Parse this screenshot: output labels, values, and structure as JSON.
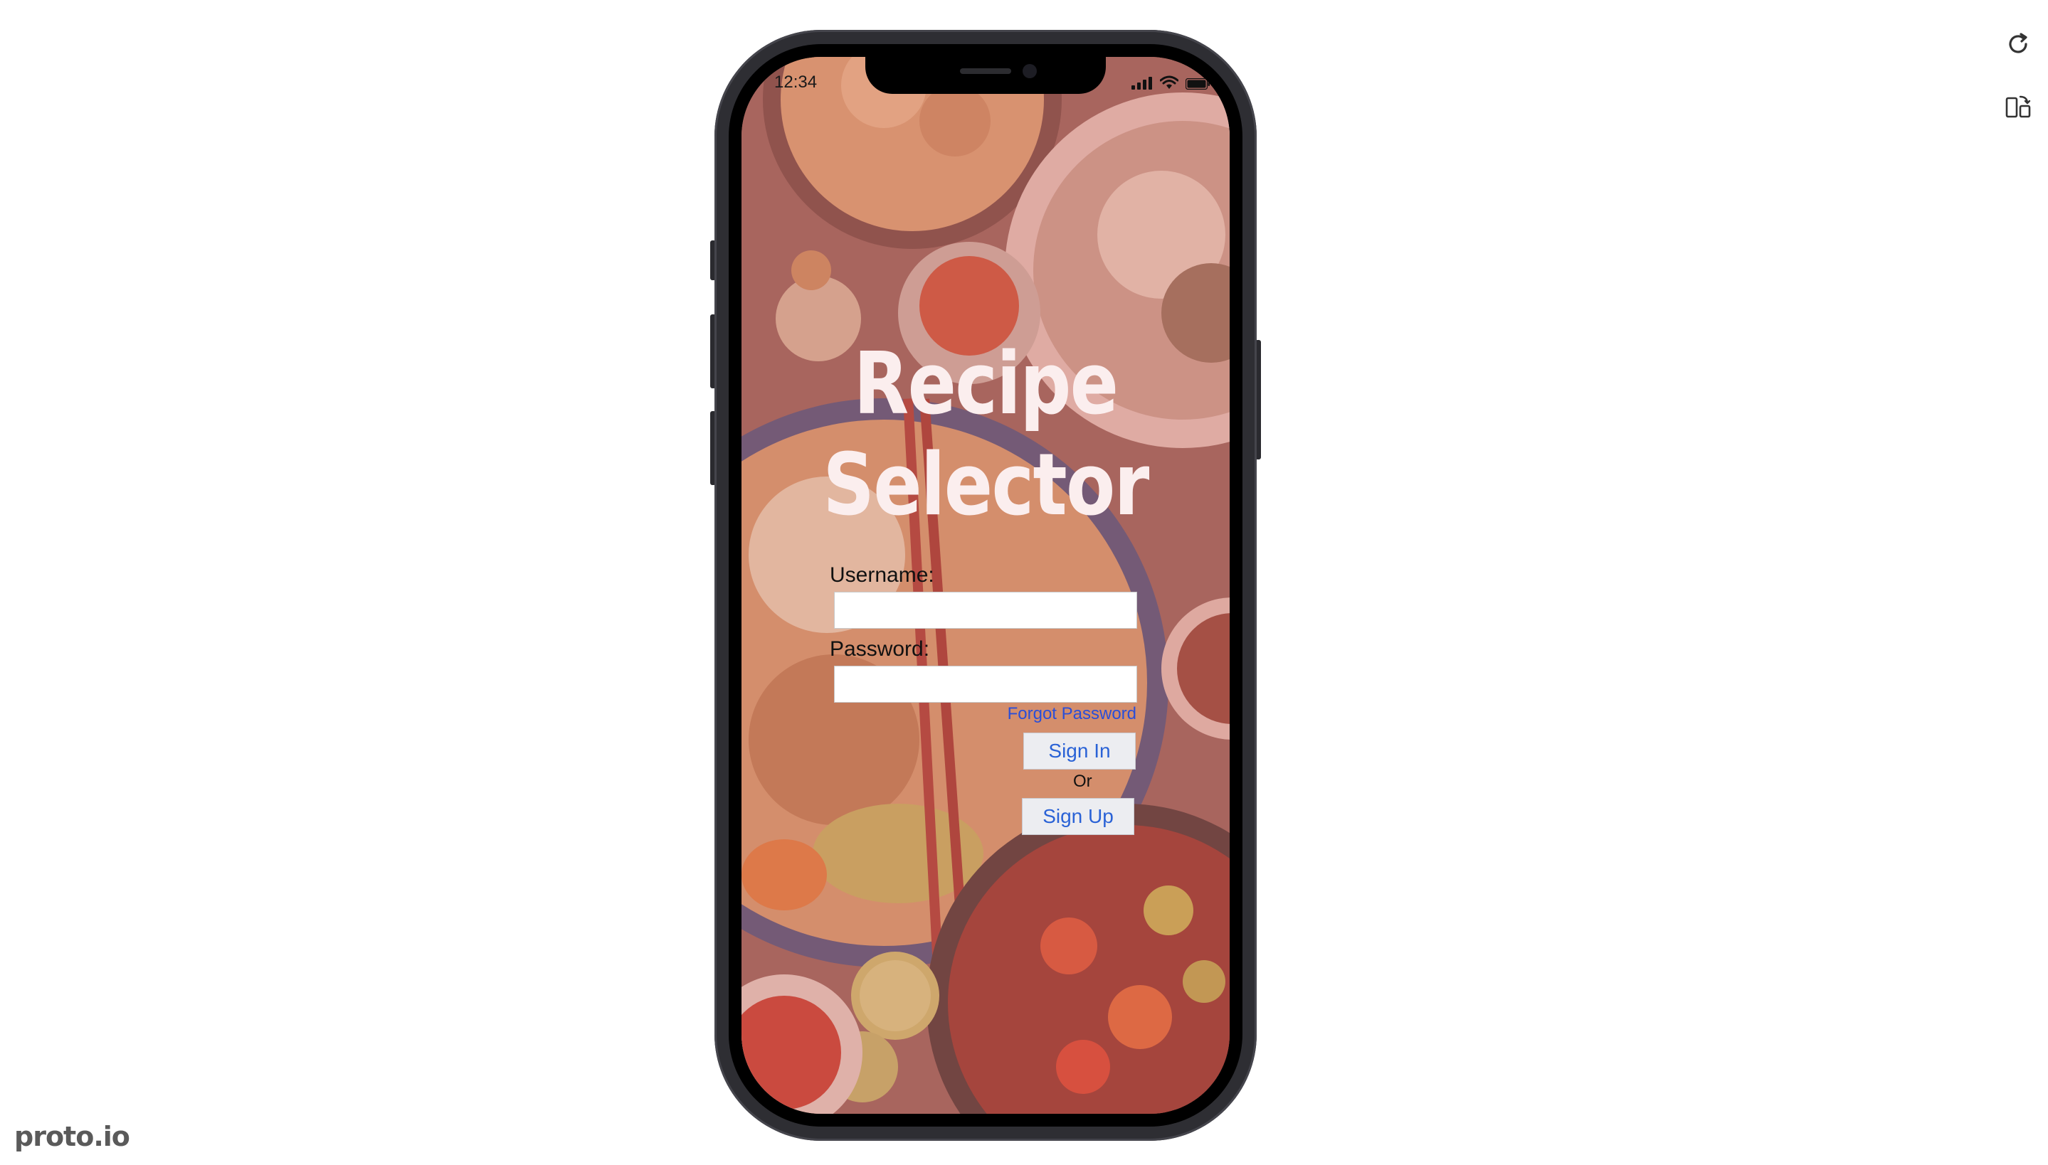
{
  "status_bar": {
    "time": "12:34",
    "icons": [
      "signal-icon",
      "wifi-icon",
      "battery-icon"
    ]
  },
  "login": {
    "title_line1": "Recipe",
    "title_line2": "Selector",
    "username_label": "Username:",
    "username_value": "",
    "password_label": "Password:",
    "password_value": "",
    "forgot_password": "Forgot Password",
    "sign_in": "Sign In",
    "or": "Or",
    "sign_up": "Sign Up"
  },
  "viewer": {
    "brand": "proto.io",
    "tools": [
      "refresh-icon",
      "rotate-device-icon"
    ]
  },
  "colors": {
    "title": "#fbeeee",
    "link": "#2a4ed8",
    "button_text": "#2a62d6",
    "button_bg": "#ecedf1",
    "phone_frame": "#2e2e33",
    "brand_text": "#5a5a5a"
  }
}
